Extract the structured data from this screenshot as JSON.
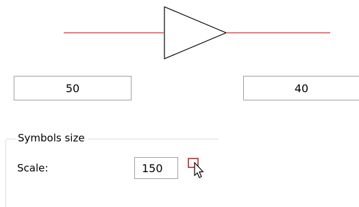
{
  "preview": {
    "line_color": "#e0282f",
    "symbol_stroke": "#000000",
    "symbol_fill": "#ffffff"
  },
  "fields": {
    "left_value": "50",
    "right_value": "40"
  },
  "symbols_group": {
    "title": "Symbols size",
    "scale_label": "Scale:",
    "scale_value": "150",
    "pick_icon": "select-region-icon",
    "pick_icon_color": "#b22a2a"
  }
}
